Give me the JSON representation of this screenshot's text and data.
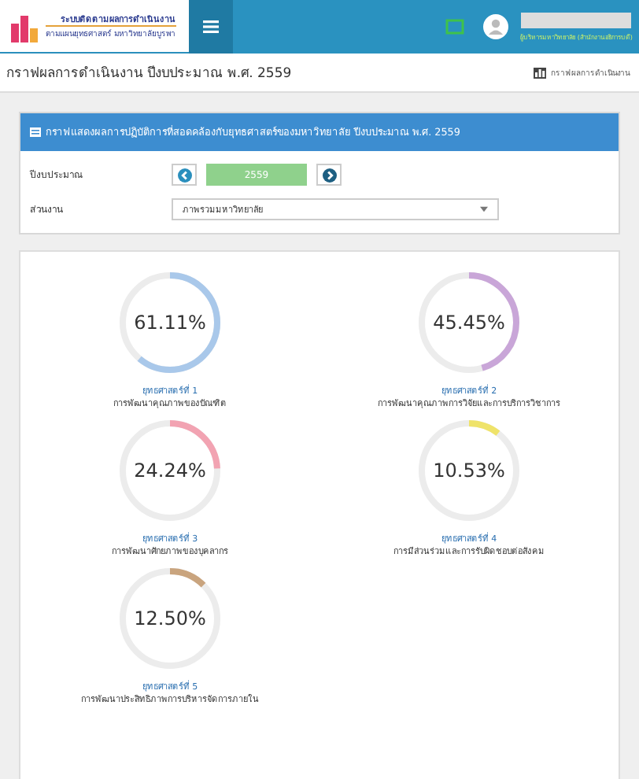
{
  "header": {
    "logo_title": "ระบบติดตามผลการดำเนินงาน",
    "logo_subtitle": "ตามแผนยุทธศาสตร์ มหาวิทยาลัยบูรพา",
    "user_role": "ผู้บริหารมหาวิทยาลัย (สำนักงานอธิการบดี)"
  },
  "page": {
    "title": "กราฟผลการดำเนินงาน ปีงบประมาณ พ.ศ. 2559",
    "breadcrumb": "กราฟผลการดำเนินงาน"
  },
  "filter_panel": {
    "heading": "กราฟแสดงผลการปฏิบัติการที่สอดคล้องกับยุทธศาสตร์ของมหาวิทยาลัย ปีงบประมาณ พ.ศ. 2559",
    "year_label": "ปีงบประมาณ",
    "year": "2559",
    "unit_label": "ส่วนงาน",
    "unit_value": "ภาพรวมมหาวิทยาลัย"
  },
  "strategies": [
    {
      "value": "61.11%",
      "level": 0.6111,
      "color": "#a9c8ea",
      "title": "ยุทธศาสตร์ที่ 1",
      "name": "การพัฒนาคุณภาพของบัณฑิต"
    },
    {
      "value": "45.45%",
      "level": 0.4545,
      "color": "#c9a6d8",
      "title": "ยุทธศาสตร์ที่ 2",
      "name": "การพัฒนาคุณภาพการวิจัยและการบริการวิชาการ"
    },
    {
      "value": "24.24%",
      "level": 0.2424,
      "color": "#f2a3b2",
      "title": "ยุทธศาสตร์ที่ 3",
      "name": "การพัฒนาศักยภาพของบุคลากร"
    },
    {
      "value": "10.53%",
      "level": 0.1053,
      "color": "#efe36a",
      "title": "ยุทธศาสตร์ที่ 4",
      "name": "การมีส่วนร่วมและการรับผิดชอบต่อสังคม"
    },
    {
      "value": "12.50%",
      "level": 0.125,
      "color": "#c9a47e",
      "title": "ยุทธศาสตร์ที่ 5",
      "name": "การพัฒนาประสิทธิภาพการบริหารจัดการภายใน"
    }
  ]
}
